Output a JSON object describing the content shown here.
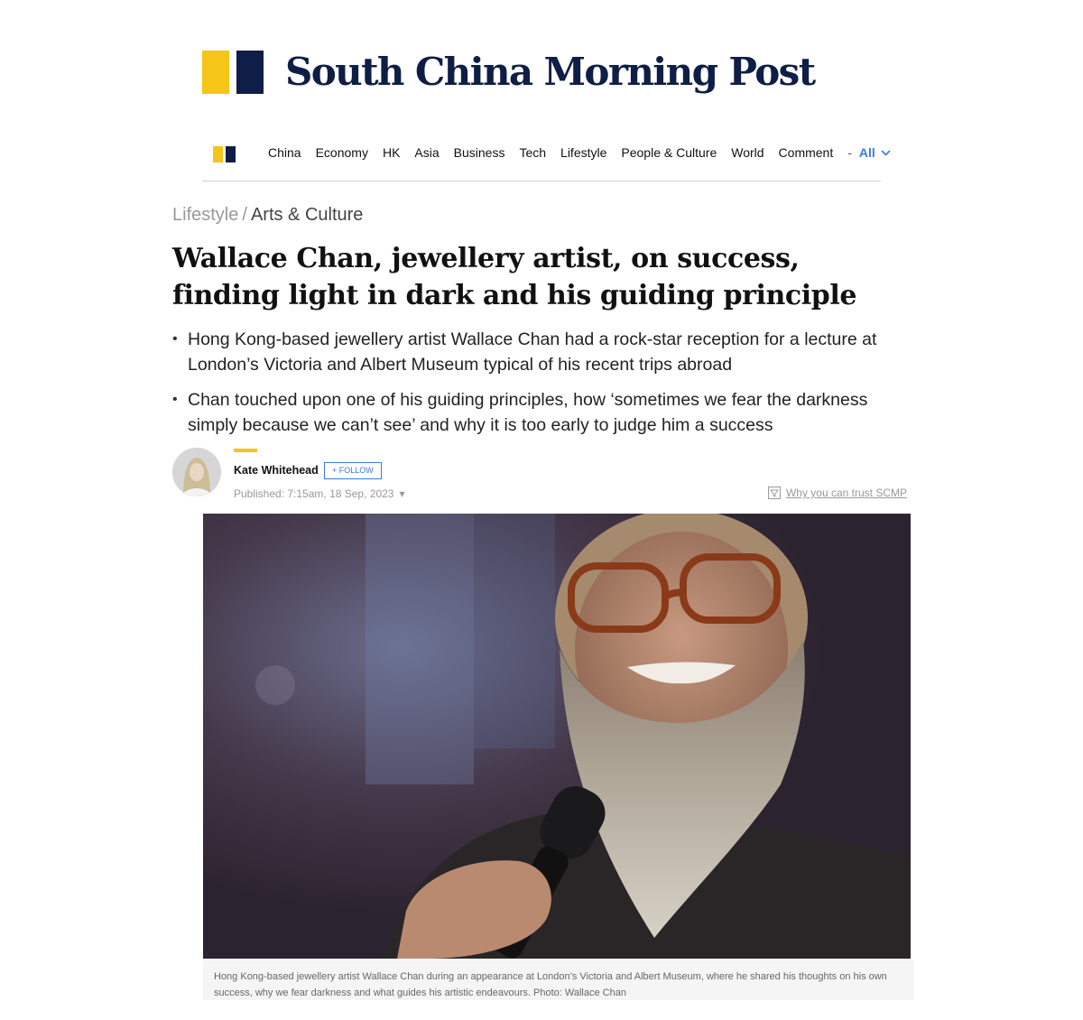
{
  "site": {
    "brand_name": "South China Morning Post",
    "colors": {
      "brand_navy": "#0f1e46",
      "brand_yellow": "#f5c518",
      "link_blue": "#3b7bdc"
    }
  },
  "nav": {
    "items": [
      "China",
      "Economy",
      "HK",
      "Asia",
      "Business",
      "Tech",
      "Lifestyle",
      "People & Culture",
      "World",
      "Comment"
    ],
    "separator": "-",
    "all_label": "All",
    "all_icon": "chevron-down-icon"
  },
  "breadcrumb": {
    "section": "Lifestyle",
    "separator": "/",
    "subsection": "Arts & Culture"
  },
  "article": {
    "headline": "Wallace Chan, jewellery artist, on success, finding light in dark and his guiding principle",
    "summary": [
      "Hong Kong-based jewellery artist Wallace Chan had a rock-star reception for a lecture at London’s Victoria and Albert Museum typical of his recent trips abroad",
      "Chan touched upon one of his guiding principles, how ‘sometimes we fear the darkness simply because we can’t see’ and why it is too early to judge him a success"
    ],
    "author": {
      "name": "Kate Whitehead",
      "follow_label": "+ FOLLOW"
    },
    "published": "Published: 7:15am, 18 Sep, 2023",
    "published_icon": "chevron-down-icon",
    "trust_label": "Why you can trust SCMP",
    "trust_icon": "shield-filter-icon",
    "photo_caption": "Hong Kong-based jewellery artist Wallace Chan during an appearance at London’s Victoria and Albert Museum, where he shared his thoughts on his own success, why we fear darkness and what guides his artistic endeavours. Photo: Wallace Chan"
  }
}
